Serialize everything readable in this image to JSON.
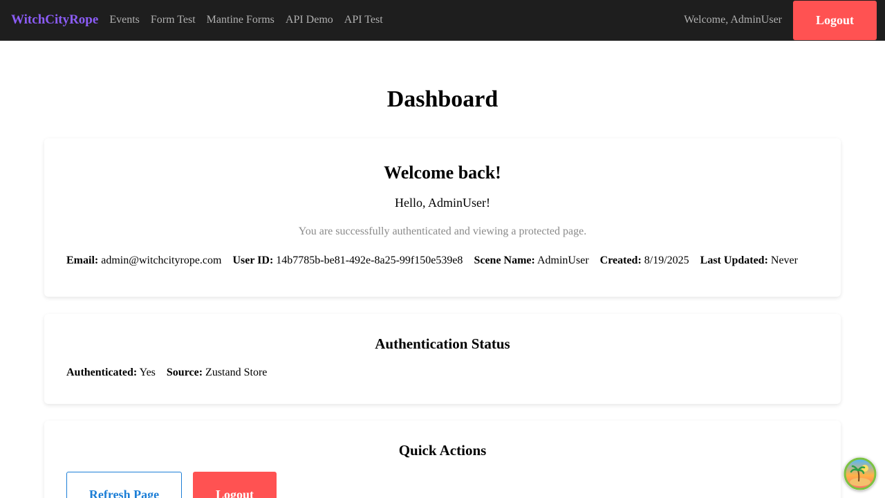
{
  "nav": {
    "brand": "WitchCityRope",
    "links": [
      "Events",
      "Form Test",
      "Mantine Forms",
      "API Demo",
      "API Test"
    ],
    "welcome": "Welcome, AdminUser",
    "logout": "Logout"
  },
  "page": {
    "title": "Dashboard"
  },
  "welcome_card": {
    "heading": "Welcome back!",
    "hello": "Hello, AdminUser!",
    "subtitle": "You are successfully authenticated and viewing a protected page.",
    "fields": [
      {
        "label": "Email:",
        "value": "admin@witchcityrope.com"
      },
      {
        "label": "User ID:",
        "value": "14b7785b-be81-492e-8a25-99f150e539e8"
      },
      {
        "label": "Scene Name:",
        "value": "AdminUser"
      },
      {
        "label": "Created:",
        "value": "8/19/2025"
      },
      {
        "label": "Last Updated:",
        "value": "Never"
      }
    ]
  },
  "auth_card": {
    "heading": "Authentication Status",
    "fields": [
      {
        "label": "Authenticated:",
        "value": "Yes"
      },
      {
        "label": "Source:",
        "value": "Zustand Store"
      }
    ]
  },
  "actions_card": {
    "heading": "Quick Actions",
    "refresh": "Refresh Page",
    "logout": "Logout"
  },
  "colors": {
    "brand": "#8b5cf6",
    "navbar_bg": "#1e1e1e",
    "danger": "#ff5252",
    "primary": "#1c7ed6"
  },
  "icons": {
    "floating_button": "beach-island-icon"
  }
}
